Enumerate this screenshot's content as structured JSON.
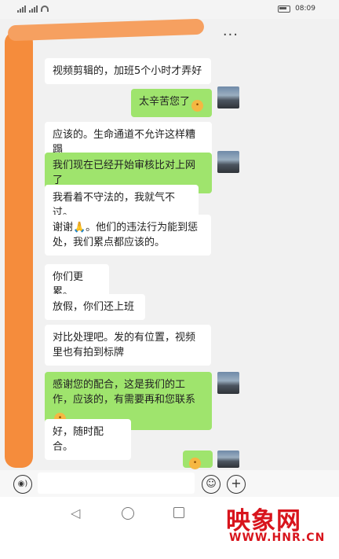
{
  "status_bar": {
    "time": "08:09",
    "battery_label": "⊞"
  },
  "header": {
    "menu_icon": "more-dots-icon",
    "menu_glyph": "···"
  },
  "messages": [
    {
      "side": "in",
      "text": "视频剪辑的，加班5个小时才弄好"
    },
    {
      "side": "out",
      "text": "太辛苦您了",
      "emoji": "😓"
    },
    {
      "side": "in",
      "text": "应该的。生命通道不允许这样糟蹋"
    },
    {
      "side": "out",
      "text": "我们现在已经开始审核比对上网了"
    },
    {
      "side": "in",
      "text": "我看着不守法的，我就气不过。"
    },
    {
      "side": "in",
      "text": "谢谢🙏。他们的违法行为能到惩处，我们累点都应该的。"
    },
    {
      "side": "in",
      "text": "你们更累。"
    },
    {
      "side": "in",
      "text": "放假，你们还上班"
    },
    {
      "side": "in",
      "text": "对比处理吧。发的有位置，视频里也有拍到标牌"
    },
    {
      "side": "out",
      "text": "感谢您的配合，这是我们的工作，应该的，有需要再和您联系",
      "emoji": "🙏"
    },
    {
      "side": "in",
      "text": "好，随时配合。"
    },
    {
      "side": "out",
      "text": "",
      "emoji": "👍"
    }
  ],
  "input_bar": {
    "voice_icon": "voice-icon",
    "voice_glyph": "◉)",
    "emoji_icon": "emoji-icon",
    "emoji_glyph": "☺",
    "plus_icon": "plus-icon",
    "plus_glyph": "+"
  },
  "nav_bar": {
    "back_glyph": "◁"
  },
  "watermark": {
    "logo": "映象网",
    "url": "WWW.HNR.CN"
  },
  "colors": {
    "outgoing_bubble": "#9fe46d",
    "incoming_bubble": "#ffffff",
    "highlight": "#f58c3c",
    "watermark": "#d8141c"
  }
}
